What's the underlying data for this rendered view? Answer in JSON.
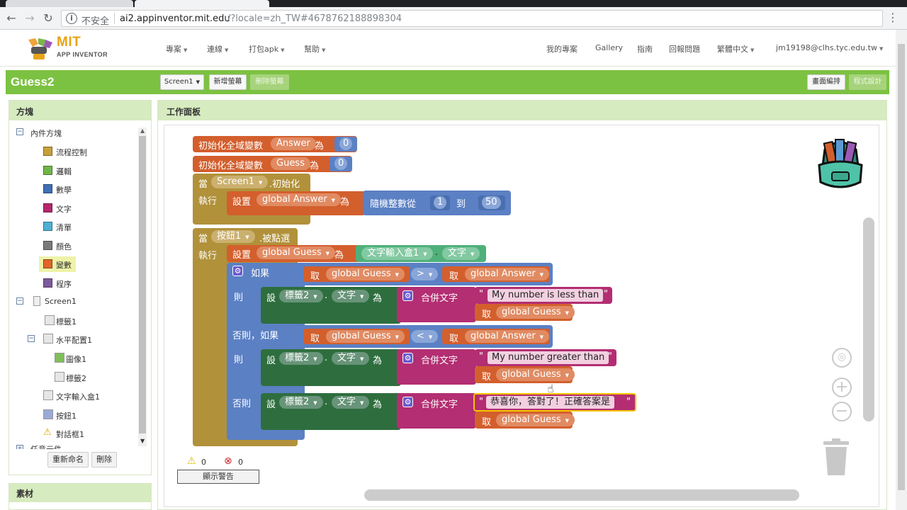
{
  "browser": {
    "security_label": "不安全",
    "url_host": "ai2.appinventor.mit.edu",
    "url_rest": "/?locale=zh_TW#4678762188898304"
  },
  "nav": {
    "logo_line1": "MIT",
    "logo_line2": "APP INVENTOR",
    "projects": "專案",
    "connect": "連線",
    "build": "打包apk",
    "help": "幫助",
    "my_projects": "我的專案",
    "gallery": "Gallery",
    "guide": "指南",
    "report": "回報問題",
    "language": "繁體中文",
    "account": "jm19198@clhs.tyc.edu.tw"
  },
  "project": {
    "name": "Guess2",
    "screen_select": "Screen1",
    "add_screen": "新增螢幕",
    "remove_screen": "刪除螢幕",
    "designer": "畫面編排",
    "blocks": "程式設計"
  },
  "palette": {
    "title": "方塊",
    "builtin": "內件方塊",
    "categories": [
      {
        "label": "流程控制",
        "color": "#c8a03a"
      },
      {
        "label": "邏輯",
        "color": "#6fb64a"
      },
      {
        "label": "數學",
        "color": "#3f6fb5"
      },
      {
        "label": "文字",
        "color": "#b4286e"
      },
      {
        "label": "清單",
        "color": "#4fb0d2"
      },
      {
        "label": "顏色",
        "color": "#7a7a7a"
      },
      {
        "label": "變數",
        "color": "#e0662b"
      },
      {
        "label": "程序",
        "color": "#7d5a9b"
      }
    ],
    "screen": "Screen1",
    "components": {
      "label1": "標籤1",
      "hlayout": "水平配置1",
      "image1": "圖像1",
      "label2": "標籤2",
      "textbox1": "文字輸入盒1",
      "button1": "按鈕1",
      "notifier1": "對話框1",
      "any": "任意元件"
    },
    "rename": "重新命名",
    "delete": "刪除",
    "media": "素材"
  },
  "workspace": {
    "title": "工作面板",
    "warnings": "0",
    "errors": "0",
    "show_warnings": "顯示警告"
  },
  "blocks": {
    "init_global": "初始化全域變數",
    "as": "為",
    "var_answer": "Answer",
    "var_guess": "Guess",
    "zero": "0",
    "when": "當",
    "screen1": "Screen1",
    "initialize": ".初始化",
    "do": "執行",
    "set": "設置",
    "set_short": "設",
    "global_answer": "global Answer",
    "global_guess": "global Guess",
    "random_int": "隨機整數從",
    "one": "1",
    "to": "到",
    "fifty": "50",
    "button1": "按鈕1",
    "click": ".被點選",
    "textbox1": "文字輸入盒1",
    "dot": ".",
    "text_prop": "文字",
    "if": "如果",
    "get": "取",
    "gt": ">",
    "lt": "<",
    "then": "則",
    "elseif": "否則，如果",
    "else": "否則",
    "label2": "標籤2",
    "join": "合併文字",
    "msg_less": "My number is less than",
    "msg_greater": "My number greater than",
    "msg_correct": "恭喜你，答對了！正確答案是"
  }
}
